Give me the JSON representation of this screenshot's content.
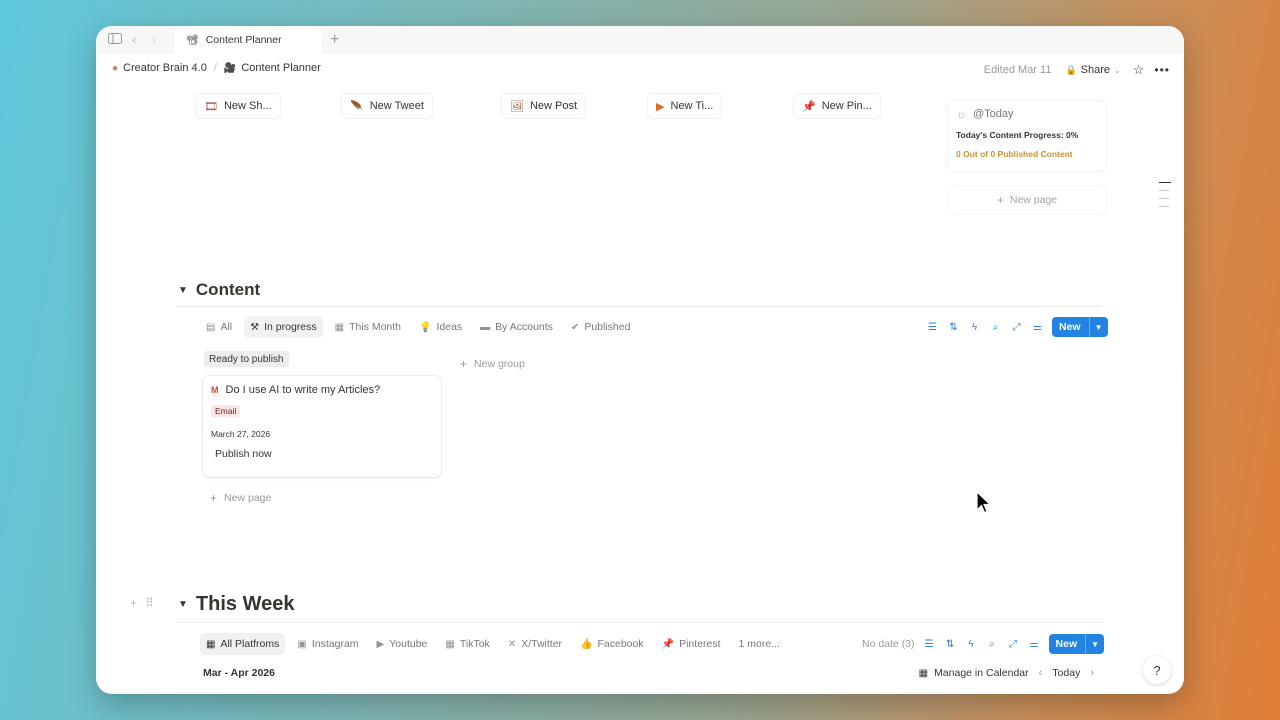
{
  "tabbar": {
    "tab_title": "Content Planner",
    "tab_icon": "📽"
  },
  "header": {
    "breadcrumb": [
      {
        "label": "Creator Brain 4.0",
        "icon": "brain-icon"
      },
      {
        "label": "Content Planner",
        "icon": "film-camera-icon"
      }
    ],
    "edited": "Edited Mar 11",
    "share_label": "Share"
  },
  "quick_buttons": [
    {
      "label": "New Sh...",
      "icon": "film-frame-icon",
      "glyph": "🎞"
    },
    {
      "label": "New Tweet",
      "icon": "feather-icon",
      "glyph": "🪶"
    },
    {
      "label": "New Post",
      "icon": "image-frame-icon",
      "glyph": "🖼"
    },
    {
      "label": "New Ti...",
      "icon": "play-circle-icon",
      "glyph": "▶"
    },
    {
      "label": "New Pin...",
      "icon": "pushpin-icon",
      "glyph": "📌"
    }
  ],
  "today_card": {
    "title": "@Today",
    "progress": "Today's Content Progress: 0%",
    "published": "0 Out of 0 Published Content"
  },
  "side_new_page": "New page",
  "content_section": {
    "title": "Content",
    "views": [
      {
        "label": "All",
        "icon": "stack-icon",
        "glyph": "▤"
      },
      {
        "label": "In progress",
        "icon": "construction-icon",
        "glyph": "⚒"
      },
      {
        "label": "This Month",
        "icon": "calendar-icon",
        "glyph": "▦"
      },
      {
        "label": "Ideas",
        "icon": "lightbulb-icon",
        "glyph": "💡"
      },
      {
        "label": "By Accounts",
        "icon": "folder-icon",
        "glyph": "▬"
      },
      {
        "label": "Published",
        "icon": "check-badge-icon",
        "glyph": "✔"
      }
    ],
    "new_label": "New",
    "group_label": "Ready to publish",
    "new_group": "New group",
    "card": {
      "title": "Do I use AI to write my Articles?",
      "tag": "Email",
      "date": "March 27, 2026",
      "action": "Publish now"
    },
    "new_page": "New page"
  },
  "week_section": {
    "title": "This Week",
    "views": [
      {
        "label": "All Platfroms",
        "icon": "calendar-icon",
        "glyph": "▦"
      },
      {
        "label": "Instagram",
        "icon": "image-frame-icon",
        "glyph": "▣"
      },
      {
        "label": "Youtube",
        "icon": "play-circle-icon",
        "glyph": "▶"
      },
      {
        "label": "TikTok",
        "icon": "film-frame-icon",
        "glyph": "▦"
      },
      {
        "label": "X/Twitter",
        "icon": "x-icon",
        "glyph": "✕"
      },
      {
        "label": "Facebook",
        "icon": "thumbs-up-icon",
        "glyph": "👍"
      },
      {
        "label": "Pinterest",
        "icon": "pushpin-icon",
        "glyph": "📌"
      },
      {
        "label": "1 more...",
        "icon": "",
        "glyph": ""
      }
    ],
    "no_date": "No date (3)",
    "new_label": "New",
    "date_range": "Mar - Apr 2026",
    "manage": "Manage in Calendar",
    "today": "Today"
  }
}
